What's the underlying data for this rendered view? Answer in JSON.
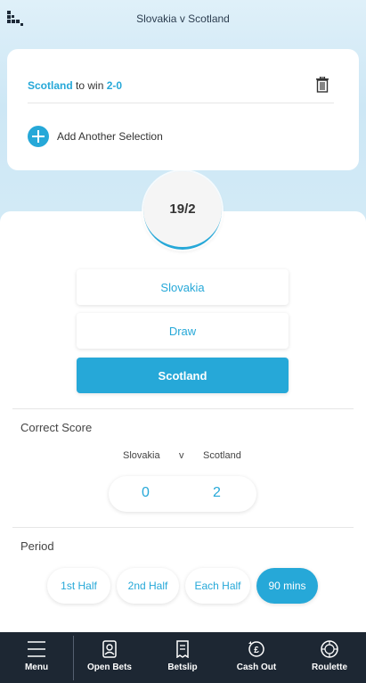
{
  "header": {
    "title": "Slovakia v Scotland",
    "logo": "grid-logo-icon"
  },
  "selection": {
    "team": "Scotland",
    "text": "to win",
    "score": "2-0",
    "remove_icon": "trash-icon",
    "add_label": "Add Another Selection"
  },
  "odds": "19/2",
  "outcomes": [
    {
      "label": "Slovakia",
      "active": false
    },
    {
      "label": "Draw",
      "active": false
    },
    {
      "label": "Scotland",
      "active": true
    }
  ],
  "correct_score": {
    "title": "Correct Score",
    "home_team": "Slovakia",
    "separator": "v",
    "away_team": "Scotland",
    "home_score": "0",
    "away_score": "2"
  },
  "period": {
    "title": "Period",
    "options": [
      {
        "label": "1st Half",
        "active": false
      },
      {
        "label": "2nd Half",
        "active": false
      },
      {
        "label": "Each Half",
        "active": false
      },
      {
        "label": "90 mins",
        "active": true
      }
    ]
  },
  "nav": [
    {
      "label": "Menu",
      "icon": "hamburger-icon"
    },
    {
      "label": "Open Bets",
      "icon": "open-bets-icon"
    },
    {
      "label": "Betslip",
      "icon": "betslip-icon"
    },
    {
      "label": "Cash Out",
      "icon": "cash-out-icon"
    },
    {
      "label": "Roulette",
      "icon": "roulette-icon"
    }
  ],
  "colors": {
    "accent": "#26a8d8",
    "nav_bg": "#1d2733"
  }
}
